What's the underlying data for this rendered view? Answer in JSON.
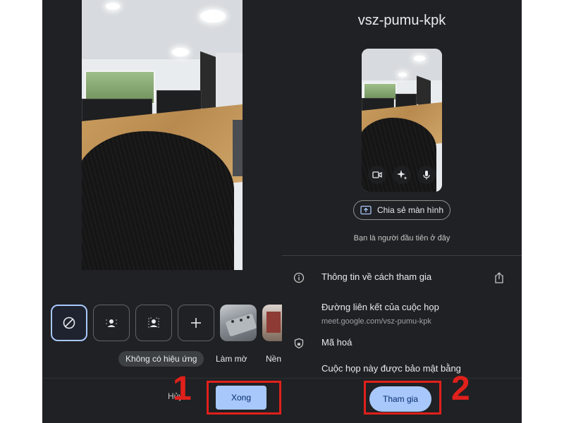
{
  "effects_panel": {
    "effect_labels": [
      "Không có hiệu ứng",
      "Làm mờ",
      "Nền"
    ],
    "cancel_label": "Hủy",
    "done_label": "Xong"
  },
  "join_panel": {
    "meeting_code": "vsz-pumu-kpk",
    "share_screen_label": "Chia sẻ màn hình",
    "first_here_text": "Bạn là người đầu tiên ở đây",
    "joining_info_title": "Thông tin về cách tham gia",
    "meeting_link_title": "Đường liên kết của cuộc họp",
    "meeting_link_url": "meet.google.com/vsz-pumu-kpk",
    "encryption_title": "Mã hoá",
    "encryption_desc": "Cuộc họp này được bảo mật bằng",
    "join_label": "Tham gia"
  },
  "annotations": {
    "step_1": "1",
    "step_2": "2",
    "highlight_color": "#e0201b"
  },
  "icons": [
    "no-effect-icon",
    "slight-blur-icon",
    "blur-icon",
    "add-icon",
    "camera-icon",
    "sparkle-effects-icon",
    "microphone-icon",
    "present-screen-icon",
    "info-icon",
    "share-icon",
    "lock-shield-icon"
  ],
  "colors": {
    "background": "#202124",
    "primary_button": "#a8c7fa",
    "primary_text": "#e8eaed"
  }
}
